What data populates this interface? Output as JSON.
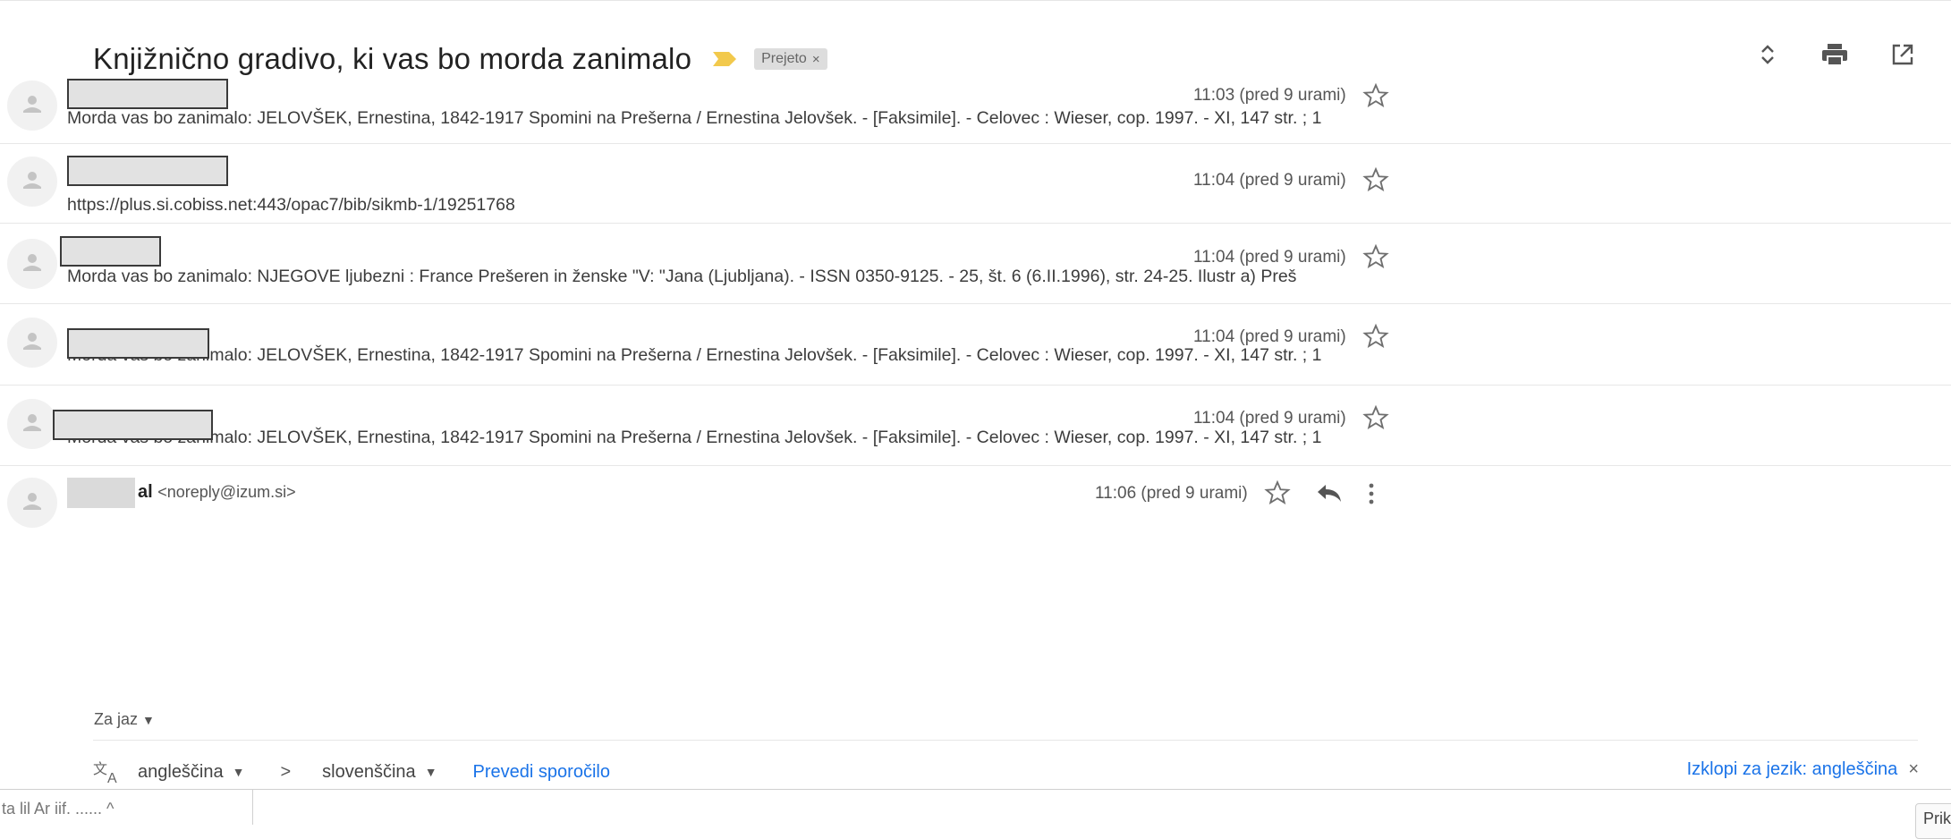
{
  "thread": {
    "subject": "Knjižnično gradivo, ki vas bo morda zanimalo",
    "label": "Prejeto",
    "label_close": "×"
  },
  "toolbar_icons": [
    "expand-collapse-icon",
    "print-icon",
    "open-new-window-icon"
  ],
  "messages": [
    {
      "time": "11:03 (pred 9 urami)",
      "snippet": "Morda vas bo zanimalo: JELOVŠEK, Ernestina, 1842-1917 Spomini na Prešerna / Ernestina Jelovšek. - [Faksimile]. - Celovec : Wieser, cop. 1997. - XI, 147 str. ; 1"
    },
    {
      "time": "11:04 (pred 9 urami)",
      "snippet": "https://plus.si.cobiss.net:443/opac7/bib/sikmb-1/19251768"
    },
    {
      "time": "11:04 (pred 9 urami)",
      "snippet": "Morda vas bo zanimalo: NJEGOVE ljubezni : France Prešeren in ženske \"V: \"Jana (Ljubljana). - ISSN 0350-9125. - 25, št. 6 (6.II.1996), str. 24-25. Ilustr a) Preš"
    },
    {
      "time": "11:04 (pred 9 urami)",
      "snippet": "Morda vas bo zanimalo: JELOVŠEK, Ernestina, 1842-1917 Spomini na Prešerna / Ernestina Jelovšek. - [Faksimile]. - Celovec : Wieser, cop. 1997. - XI, 147 str. ; 1"
    },
    {
      "time": "11:04 (pred 9 urami)",
      "snippet": "Morda vas bo zanimalo: JELOVŠEK, Ernestina, 1842-1917 Spomini na Prešerna / Ernestina Jelovšek. - [Faksimile]. - Celovec : Wieser, cop. 1997. - XI, 147 str. ; 1"
    }
  ],
  "open_message": {
    "sender_suffix": "al",
    "sender_email": "<noreply@izum.si>",
    "time": "11:06 (pred 9 urami)",
    "recipient": "Za jaz"
  },
  "translation": {
    "source_lang": "angleščina",
    "arrow": ">",
    "target_lang": "slovenščina",
    "translate_link": "Prevedi sporočilo",
    "turn_off": "Izklopi za jezik: angleščina",
    "close": "×"
  },
  "bottom": {
    "partial_text": "ta lil  Ar iif. ......   ^",
    "button_partial": "Prika"
  },
  "colors": {
    "link": "#1a73e8",
    "importance_marker": "#f2c94c",
    "label_chip": "#dddddd"
  }
}
